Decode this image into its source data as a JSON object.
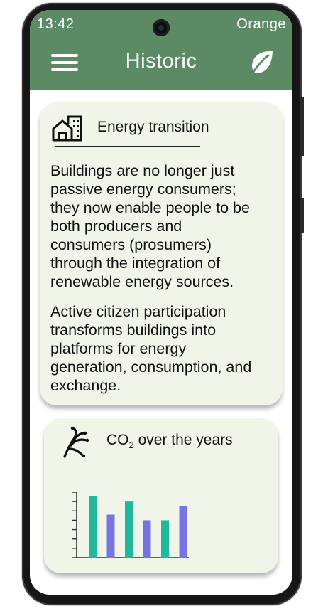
{
  "status_bar": {
    "time": "13:42",
    "carrier": "Orange"
  },
  "app_bar": {
    "title": "Historic",
    "menu_icon": "hamburger-menu-icon",
    "action_icon": "leaf-icon"
  },
  "energy_card": {
    "icon": "building-icon",
    "title": "Energy transition",
    "paragraph_1_lines": [
      "Buildings are no longer just",
      "passive energy consumers;",
      "they now enable people to be",
      "both producers and",
      "consumers (prosumers)",
      "through the integration of",
      "renewable energy sources."
    ],
    "paragraph_2_lines": [
      "Active citizen participation",
      "transforms buildings into",
      "platforms for energy",
      "generation, consumption, and",
      "exchange."
    ]
  },
  "co2_card": {
    "icon": "branching-arrows-icon",
    "title_main": "CO",
    "title_subscript": "2",
    "title_rest": " over the years"
  },
  "chart_data": {
    "type": "bar",
    "title": "",
    "ylim": [
      0,
      7
    ],
    "y_ticks": 7,
    "values": [
      6.6,
      4.6,
      6.0,
      4.0,
      4.0,
      5.5
    ],
    "colors": [
      "#1fb89a",
      "#7674e0",
      "#1fb89a",
      "#7674e0",
      "#1fb89a",
      "#7674e0"
    ]
  },
  "colors": {
    "accent": "#5b8a64",
    "card_bg": "#f1f4e9",
    "teal": "#1fb89a",
    "violet": "#7674e0"
  }
}
